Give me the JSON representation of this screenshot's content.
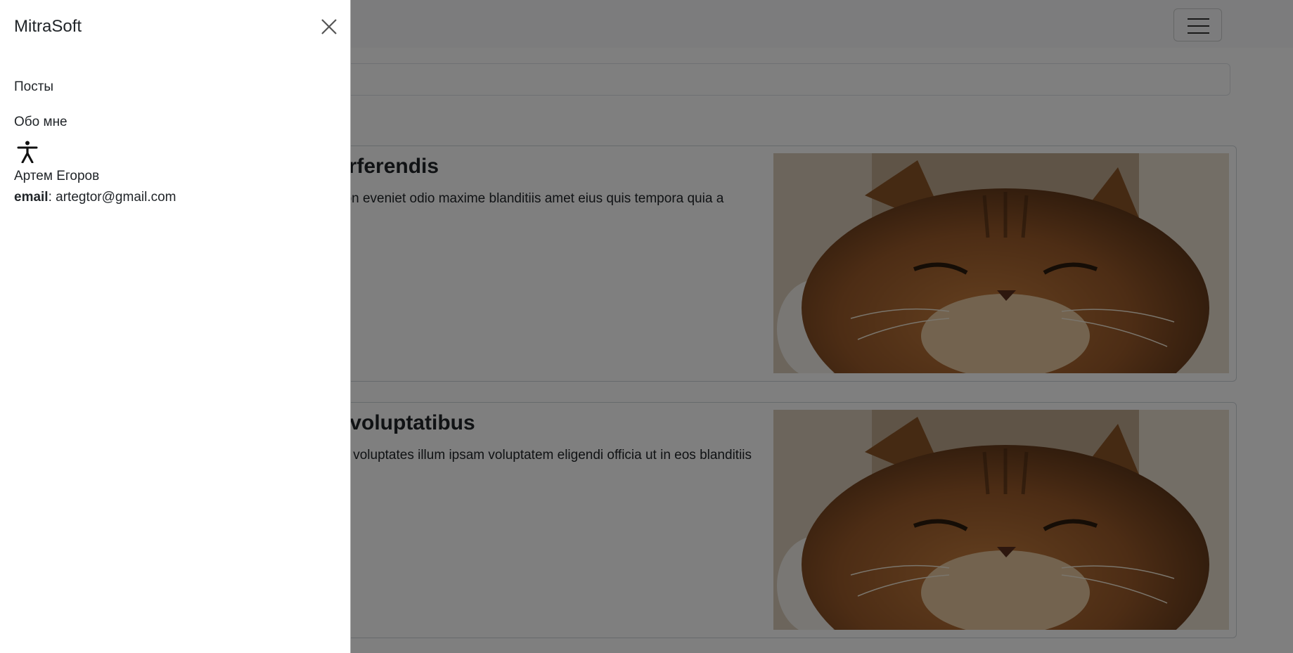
{
  "offcanvas": {
    "brand": "MitraSoft",
    "nav": [
      {
        "label": "Посты"
      },
      {
        "label": "Обо мне"
      }
    ],
    "user": {
      "name": "Артем Егоров",
      "email_label": "email",
      "email_sep": ":",
      "email": "artegtor@gmail.com"
    }
  },
  "posts": [
    {
      "title": "erferendis",
      "body": "non eveniet odio maxime blanditiis amet eius quis tempora quia a"
    },
    {
      "title": "t voluptatibus",
      "body": "ici voluptates illum ipsam voluptatem eligendi officia ut in eos blanditiis"
    }
  ],
  "icons": {
    "close": "close-icon",
    "person": "accessibility-person-icon",
    "menu": "hamburger-menu-icon"
  },
  "colors": {
    "backdrop": "#000000",
    "text": "#212529",
    "navbar": "#f8f9fa"
  }
}
